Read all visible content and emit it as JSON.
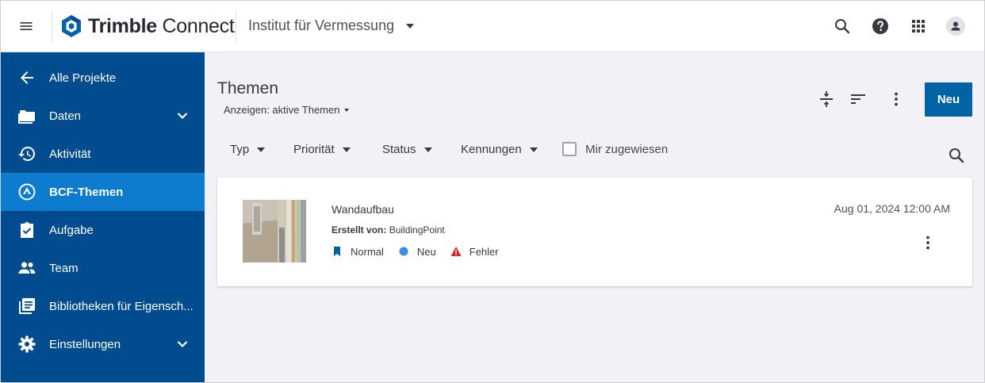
{
  "header": {
    "brand_bold": "Trimble",
    "brand_light": "Connect",
    "project": "Institut für Vermessung"
  },
  "sidebar": {
    "items": [
      {
        "label": "Alle Projekte",
        "icon": "arrow-left-icon"
      },
      {
        "label": "Daten",
        "icon": "folder-icon"
      },
      {
        "label": "Aktivität",
        "icon": "history-icon"
      },
      {
        "label": "BCF-Themen",
        "icon": "bcf-topics-icon",
        "active": true
      },
      {
        "label": "Aufgabe",
        "icon": "clipboard-check-icon"
      },
      {
        "label": "Team",
        "icon": "people-icon"
      },
      {
        "label": "Bibliotheken für Eigensch...",
        "icon": "library-icon"
      },
      {
        "label": "Einstellungen",
        "icon": "gear-icon"
      }
    ]
  },
  "main": {
    "title": "Themen",
    "view_select": "Anzeigen: aktive Themen",
    "new_button": "Neu",
    "filters": [
      "Typ",
      "Priorität",
      "Status",
      "Kennungen"
    ],
    "assigned_to_me": "Mir zugewiesen"
  },
  "topics": [
    {
      "title": "Wandaufbau",
      "author_label": "Erstellt von:",
      "author": "BuildingPoint",
      "priority": "Normal",
      "status": "Neu",
      "type": "Fehler",
      "date": "Aug 01, 2024 12:00 AM"
    }
  ],
  "colors": {
    "sidebar_bg": "#004c8e",
    "sidebar_active": "#0d7ccf",
    "primary_button": "#0063a3",
    "status_new": "#3f8ddf",
    "type_error": "#da212c",
    "priority_flag": "#0063a3"
  }
}
